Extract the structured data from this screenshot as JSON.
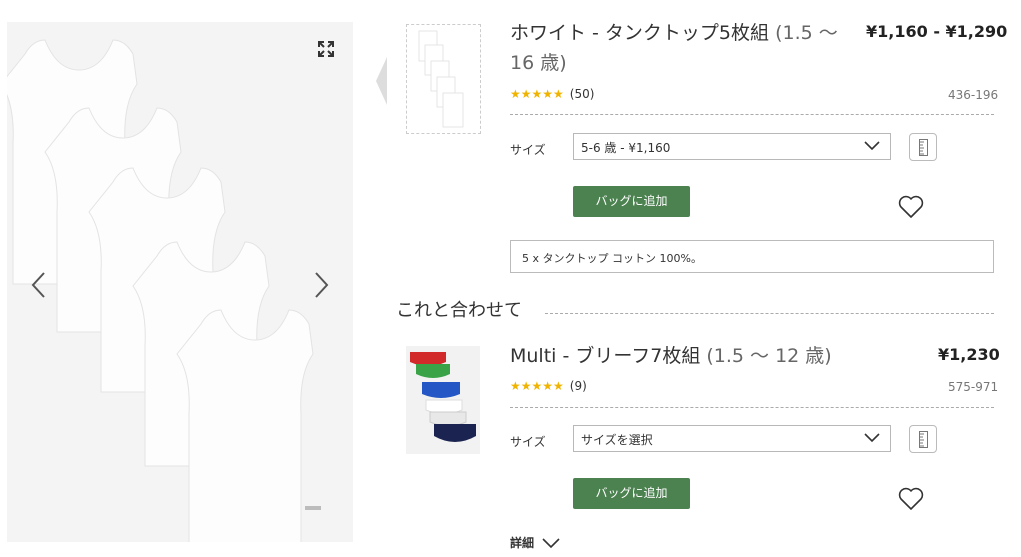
{
  "product1": {
    "title_main": "ホワイト - タンクトップ5枚組",
    "title_age": " (1.5 〜",
    "title_age2": "16 歳)",
    "price": "¥1,160 - ¥1,290",
    "stars": "★★★★★",
    "rating_count": "(50)",
    "code": "436-196",
    "size_label": "サイズ",
    "size_value": "5-6 歳 - ¥1,160",
    "bag_button": "バッグに追加",
    "description": "5 x タンクトップ コットン 100%。"
  },
  "section": {
    "title": "これと合わせて"
  },
  "product2": {
    "title_main": "Multi - ブリーフ7枚組",
    "title_age": " (1.5 〜 12 歳)",
    "price": "¥1,230",
    "stars": "★★★★★",
    "rating_count": "(9)",
    "code": "575-971",
    "size_label": "サイズ",
    "size_value": "サイズを選択",
    "bag_button": "バッグに追加",
    "details_label": "詳細"
  },
  "icons": {
    "expand": "expand-icon",
    "prev_image": "chevron-left-icon",
    "next_image": "chevron-right-icon",
    "thumb_prev": "chevron-left-icon",
    "dropdown": "chevron-down-icon",
    "size_guide": "ruler-icon",
    "favourite": "heart-icon"
  },
  "colors": {
    "bag_button": "#4b8250",
    "stars": "#f0b400",
    "image_background": "#f4f4f4"
  }
}
